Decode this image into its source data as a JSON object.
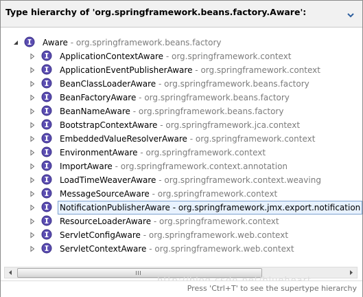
{
  "title": "Type hierarchy of 'org.springframework.beans.factory.Aware':",
  "root": {
    "name": "Aware",
    "package": "org.springframework.beans.factory"
  },
  "separator": " - ",
  "children": [
    {
      "name": "ApplicationContextAware",
      "package": "org.springframework.context"
    },
    {
      "name": "ApplicationEventPublisherAware",
      "package": "org.springframework.context"
    },
    {
      "name": "BeanClassLoaderAware",
      "package": "org.springframework.beans.factory"
    },
    {
      "name": "BeanFactoryAware",
      "package": "org.springframework.beans.factory"
    },
    {
      "name": "BeanNameAware",
      "package": "org.springframework.beans.factory"
    },
    {
      "name": "BootstrapContextAware",
      "package": "org.springframework.jca.context"
    },
    {
      "name": "EmbeddedValueResolverAware",
      "package": "org.springframework.context"
    },
    {
      "name": "EnvironmentAware",
      "package": "org.springframework.context"
    },
    {
      "name": "ImportAware",
      "package": "org.springframework.context.annotation"
    },
    {
      "name": "LoadTimeWeaverAware",
      "package": "org.springframework.context.weaving"
    },
    {
      "name": "MessageSourceAware",
      "package": "org.springframework.context"
    },
    {
      "name": "NotificationPublisherAware",
      "package": "org.springframework.jmx.export.notification",
      "selected": true
    },
    {
      "name": "ResourceLoaderAware",
      "package": "org.springframework.context"
    },
    {
      "name": "ServletConfigAware",
      "package": "org.springframework.web.context"
    },
    {
      "name": "ServletContextAware",
      "package": "org.springframework.web.context"
    }
  ],
  "status_text": "Press 'Ctrl+T' to see the supertype hierarchy",
  "watermark": "http://blog.csdn.net/blueheart",
  "colors": {
    "interface_icon": "#5b4db1",
    "selection_bg": "#e8f2fe",
    "selection_border": "#7da2ce",
    "package_text": "#7b7b7b"
  },
  "icons": {
    "menu": "chevron-down-icon",
    "expanded": "twisty-expanded-icon",
    "collapsed": "twisty-collapsed-icon",
    "interface": "interface-icon"
  }
}
